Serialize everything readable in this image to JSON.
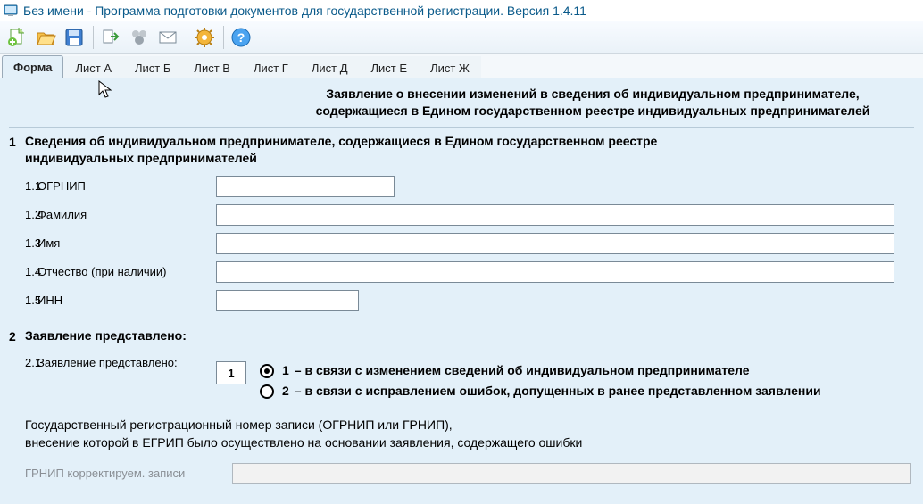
{
  "window": {
    "title": "Без имени - Программа подготовки документов для государственной регистрации. Версия 1.4.11"
  },
  "toolbar": {
    "new": "Создать",
    "open": "Открыть",
    "save": "Сохранить",
    "export": "Экспорт",
    "send": "Передать",
    "mail": "Почта",
    "settings": "Настройки",
    "help": "Справка"
  },
  "tabs": [
    "Форма",
    "Лист А",
    "Лист Б",
    "Лист В",
    "Лист Г",
    "Лист Д",
    "Лист Е",
    "Лист Ж"
  ],
  "active_tab": 0,
  "form_title": "Заявление о внесении изменений в сведения об индивидуальном предпринимателе, содержащиеся в Едином государственном реестре индивидуальных предпринимателей",
  "section1": {
    "num": "1",
    "head": "Сведения об индивидуальном предпринимателе, содержащиеся в Едином государственном реестре индивидуальных предпринимателей",
    "fields": [
      {
        "num": "1.1",
        "label": "ОГРНИП",
        "value": "",
        "wide": false
      },
      {
        "num": "1.2",
        "label": "Фамилия",
        "value": "",
        "wide": true
      },
      {
        "num": "1.3",
        "label": "Имя",
        "value": "",
        "wide": true
      },
      {
        "num": "1.4",
        "label": "Отчество (при наличии)",
        "value": "",
        "wide": true
      },
      {
        "num": "1.5",
        "label": "ИНН",
        "value": "",
        "wide": false
      }
    ]
  },
  "section2": {
    "num": "2",
    "head": "Заявление представлено:",
    "sub_num": "2.1",
    "sub_label": "Заявление представлено:",
    "selected": "1",
    "options": [
      {
        "n": "1",
        "text": "– в связи с изменением сведений об индивидуальном предпринимателе"
      },
      {
        "n": "2",
        "text": "– в связи с исправлением ошибок, допущенных в ранее представленном заявлении"
      }
    ],
    "note": "Государственный регистрационный номер записи (ОГРНИП или ГРНИП),\nвнесение которой в ЕГРИП  было осуществлено на основании заявления, содержащего ошибки",
    "disabled_label": "ГРНИП корректируем. записи"
  }
}
